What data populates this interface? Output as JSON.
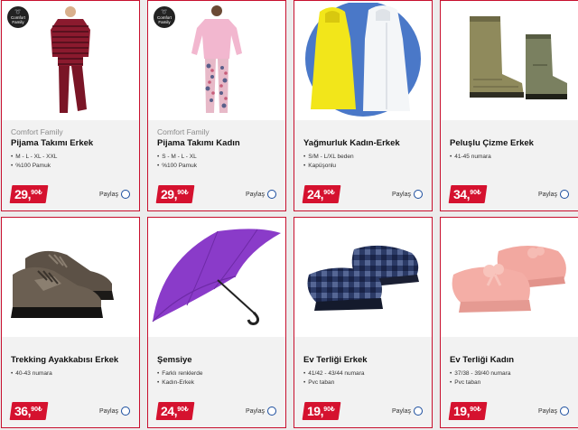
{
  "products": [
    {
      "brand": "Comfort Family",
      "title": "Pijama Takımı Erkek",
      "bullets": [
        "M - L - XL - XXL",
        "%100 Pamuk"
      ],
      "price_int": "29,",
      "price_dec": "90₺",
      "share": "Paylaş",
      "badge": [
        "Comfort",
        "Family"
      ]
    },
    {
      "brand": "Comfort Family",
      "title": "Pijama Takımı Kadın",
      "bullets": [
        "S - M - L - XL",
        "%100 Pamuk"
      ],
      "price_int": "29,",
      "price_dec": "90₺",
      "share": "Paylaş",
      "badge": [
        "Comfort",
        "Family"
      ]
    },
    {
      "brand": "",
      "title": "Yağmurluk Kadın-Erkek",
      "bullets": [
        "S/M - L/XL beden",
        "Kapüşonlu"
      ],
      "price_int": "24,",
      "price_dec": "90₺",
      "share": "Paylaş"
    },
    {
      "brand": "",
      "title": "Peluşlu Çizme Erkek",
      "bullets": [
        "41-45 numara"
      ],
      "price_int": "34,",
      "price_dec": "90₺",
      "share": "Paylaş"
    },
    {
      "brand": "",
      "title": "Trekking Ayakkabısı Erkek",
      "bullets": [
        "40-43 numara"
      ],
      "price_int": "36,",
      "price_dec": "90₺",
      "share": "Paylaş"
    },
    {
      "brand": "",
      "title": "Şemsiye",
      "bullets": [
        "Farklı renklerde",
        "Kadın-Erkek"
      ],
      "price_int": "24,",
      "price_dec": "90₺",
      "share": "Paylaş"
    },
    {
      "brand": "",
      "title": "Ev Terliği Erkek",
      "bullets": [
        "41/42 - 43/44 numara",
        "Pvc taban"
      ],
      "price_int": "19,",
      "price_dec": "90₺",
      "share": "Paylaş"
    },
    {
      "brand": "",
      "title": "Ev Terliği Kadın",
      "bullets": [
        "37/38 - 39/40 numara",
        "Pvc taban"
      ],
      "price_int": "19,",
      "price_dec": "90₺",
      "share": "Paylaş"
    }
  ],
  "colors": {
    "border": "#c8102e",
    "price_bg": "#d5122f",
    "share_circle": "#1a4d9e"
  }
}
